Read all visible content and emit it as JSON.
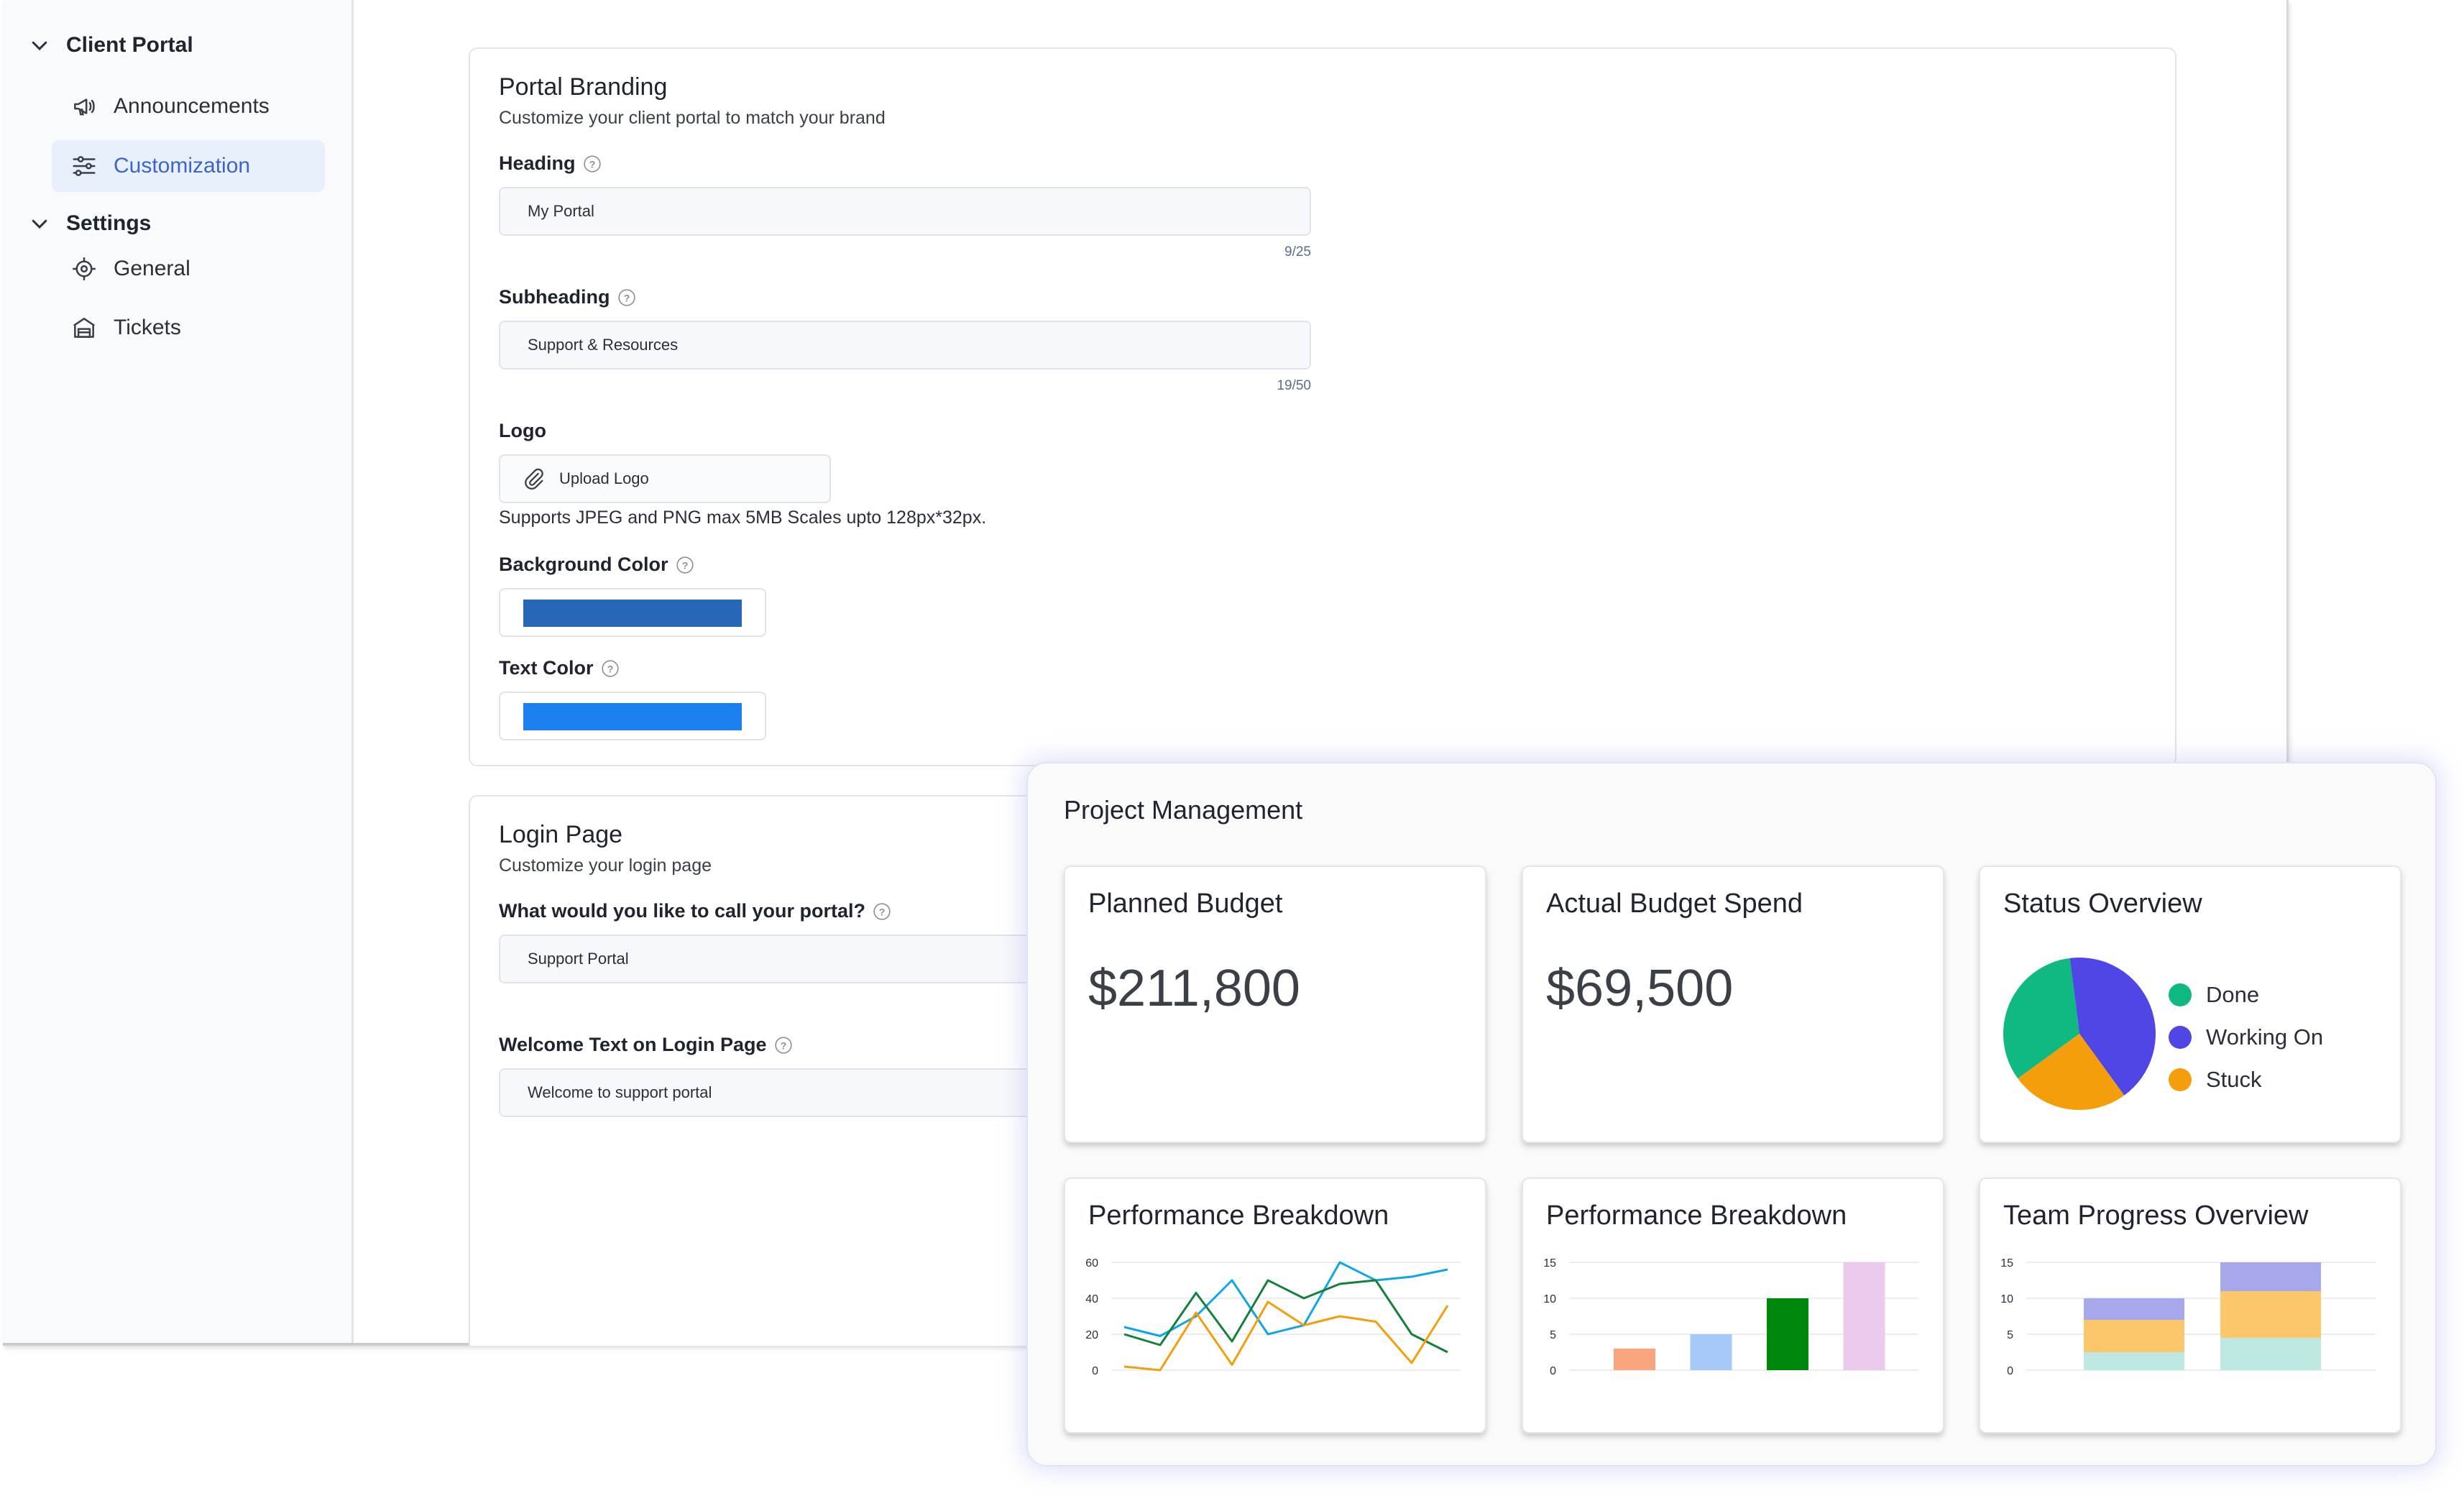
{
  "sidebar": {
    "groups": [
      {
        "label": "Client Portal",
        "items": [
          {
            "label": "Announcements",
            "icon": "megaphone-icon"
          },
          {
            "label": "Customization",
            "icon": "sliders-icon",
            "active": true
          }
        ]
      },
      {
        "label": "Settings",
        "items": [
          {
            "label": "General",
            "icon": "gear-icon"
          },
          {
            "label": "Tickets",
            "icon": "ticket-building-icon"
          }
        ]
      }
    ]
  },
  "branding": {
    "title": "Portal Branding",
    "subtitle": "Customize your client portal to match your brand",
    "heading": {
      "label": "Heading",
      "value": "My Portal",
      "counter": "9/25"
    },
    "subheading": {
      "label": "Subheading",
      "value": "Support & Resources",
      "counter": "19/50"
    },
    "logo": {
      "label": "Logo",
      "button": "Upload Logo",
      "hint": "Supports JPEG and PNG max 5MB Scales upto 128px*32px."
    },
    "background_color": {
      "label": "Background Color",
      "value": "#2667b8"
    },
    "text_color": {
      "label": "Text Color",
      "value": "#1c80f0"
    }
  },
  "login": {
    "title": "Login Page",
    "subtitle": "Customize your login page",
    "portal_name": {
      "label": "What would you like to call your portal?",
      "value": "Support Portal"
    },
    "welcome": {
      "label": "Welcome Text on Login Page",
      "value": "Welcome to support portal"
    }
  },
  "dashboard": {
    "title": "Project Management",
    "planned": {
      "title": "Planned Budget",
      "value": "$211,800"
    },
    "actual": {
      "title": "Actual Budget Spend",
      "value": "$69,500"
    },
    "status": {
      "title": "Status Overview"
    },
    "perf_line": {
      "title": "Performance Breakdown"
    },
    "perf_bar": {
      "title": "Performance Breakdown"
    },
    "team": {
      "title": "Team Progress Overview"
    }
  },
  "chart_data": [
    {
      "type": "pie",
      "labels": [
        "Done",
        "Working On",
        "Stuck"
      ],
      "values": [
        33,
        42,
        25
      ],
      "colors": [
        "#10b981",
        "#4f46e5",
        "#f59e0b"
      ],
      "legend": "right"
    },
    {
      "type": "line",
      "x": [
        0,
        1,
        2,
        3,
        4,
        5,
        6,
        7,
        8,
        9
      ],
      "ylim": [
        0,
        60
      ],
      "yticks": [
        "0",
        "20",
        "40",
        "60"
      ],
      "grid": true,
      "series": [
        {
          "color": "#0ea5e9",
          "values": [
            24,
            19,
            30,
            50,
            20,
            25,
            60,
            50,
            52,
            56
          ]
        },
        {
          "color": "#15803d",
          "values": [
            20,
            14,
            43,
            16,
            50,
            40,
            48,
            50,
            20,
            10
          ]
        },
        {
          "color": "#f59e0b",
          "values": [
            2,
            0,
            32,
            3,
            38,
            25,
            30,
            27,
            4,
            36
          ]
        }
      ]
    },
    {
      "type": "bar",
      "values": [
        3,
        5,
        10,
        15
      ],
      "colors": [
        "#fba57f",
        "#a5c8f8",
        "#00880c",
        "#ebcaee"
      ],
      "ylim": [
        0,
        15
      ],
      "yticks": [
        "0",
        "5",
        "10",
        "15"
      ],
      "grid": true
    },
    {
      "type": "bar",
      "stacked": true,
      "ylim": [
        0,
        15
      ],
      "yticks": [
        "0",
        "5",
        "10",
        "15"
      ],
      "grid": true,
      "series": [
        {
          "color": "#bfe8e2",
          "values": [
            2.5,
            4.5
          ]
        },
        {
          "color": "#fcc66b",
          "values": [
            4.5,
            6.5
          ]
        },
        {
          "color": "#a7a8ec",
          "values": [
            3,
            4
          ]
        }
      ]
    }
  ]
}
